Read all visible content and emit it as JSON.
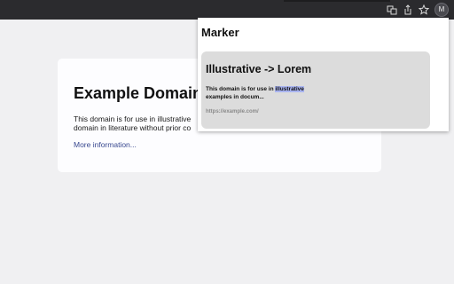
{
  "browser": {
    "icons": [
      "translate-icon",
      "share-icon",
      "star-icon"
    ],
    "avatar_initial": "M"
  },
  "page": {
    "title": "Example Domain",
    "paragraph_line1": "This domain is for use in illustrative",
    "paragraph_line2": "domain in literature without prior co",
    "link": "More information..."
  },
  "popup": {
    "title": "Marker",
    "card": {
      "heading": "Illustrative -> Lorem",
      "snippet_before": "This domain is for use in ",
      "snippet_highlight": "illustrative",
      "snippet_after": "examples in docum...",
      "url": "https://example.com/",
      "highlight_color": "#a9b4f0"
    }
  },
  "colors": {
    "topbar": "#2b2b2e",
    "page_bg": "#f0f0f2",
    "card_bg": "#dcdcdc",
    "link": "#38488f"
  }
}
